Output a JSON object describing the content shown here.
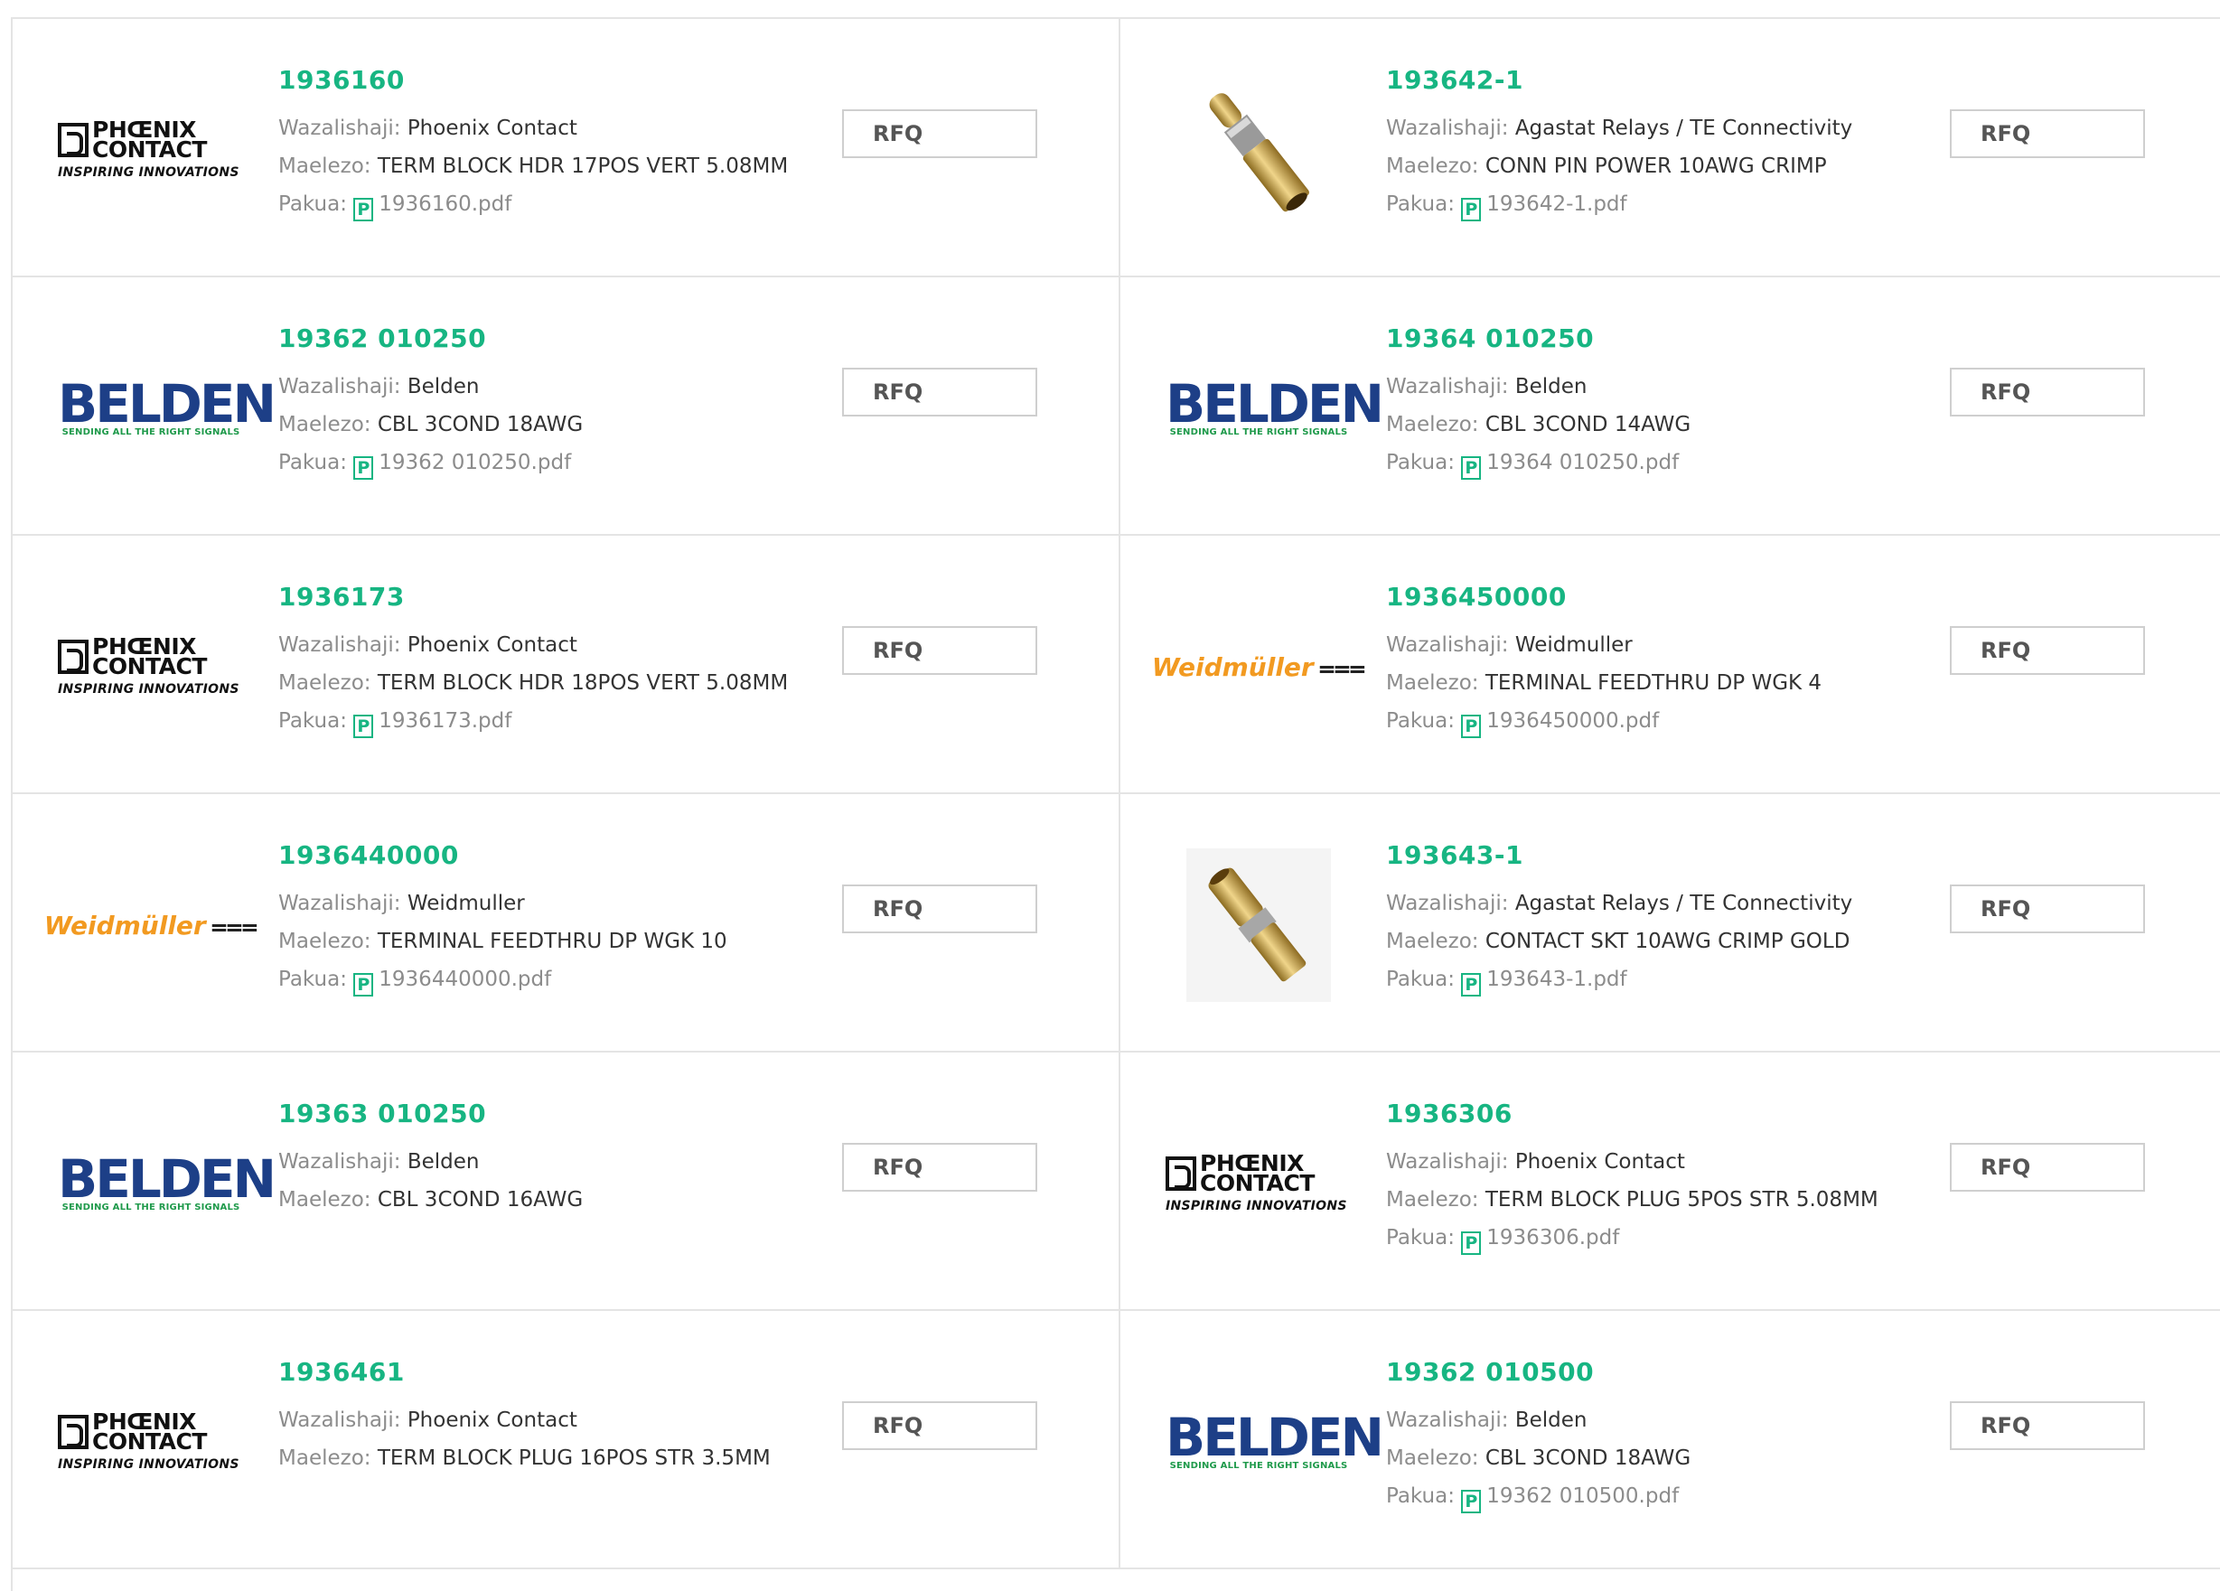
{
  "labels": {
    "manufacturer": "Wazalishaji:",
    "description": "Maelezo:",
    "package": "Pakua:",
    "rfq": "RFQ",
    "pdf_glyph": "P"
  },
  "logos": {
    "phoenix": {
      "line1": "PHŒNIX",
      "line2": "CONTACT",
      "tagline": "INSPIRING INNOVATIONS"
    },
    "belden": {
      "word": "BELDEN",
      "tagline": "SENDING ALL THE RIGHT SIGNALS"
    },
    "weidmuller": {
      "word": "Weidmüller",
      "symbol": "⩶"
    }
  },
  "colors": {
    "accent": "#17b582",
    "border": "#e4e4e4",
    "text": "#333333",
    "label": "#8c8c8c"
  },
  "products": [
    {
      "part": "1936160",
      "manufacturer": "Phoenix Contact",
      "description": "TERM BLOCK HDR 17POS VERT 5.08MM",
      "pdf": "1936160.pdf",
      "logo": "phoenix"
    },
    {
      "part": "193642-1",
      "manufacturer": "Agastat Relays / TE Connectivity",
      "description": "CONN PIN POWER 10AWG CRIMP",
      "pdf": "193642-1.pdf",
      "logo": "pin-photo"
    },
    {
      "part": "19362 010250",
      "manufacturer": "Belden",
      "description": "CBL 3COND 18AWG",
      "pdf": "19362 010250.pdf",
      "logo": "belden"
    },
    {
      "part": "19364 010250",
      "manufacturer": "Belden",
      "description": "CBL 3COND 14AWG",
      "pdf": "19364 010250.pdf",
      "logo": "belden"
    },
    {
      "part": "1936173",
      "manufacturer": "Phoenix Contact",
      "description": "TERM BLOCK HDR 18POS VERT 5.08MM",
      "pdf": "1936173.pdf",
      "logo": "phoenix"
    },
    {
      "part": "1936450000",
      "manufacturer": "Weidmuller",
      "description": "TERMINAL FEEDTHRU DP WGK 4",
      "pdf": "1936450000.pdf",
      "logo": "weidmuller"
    },
    {
      "part": "1936440000",
      "manufacturer": "Weidmuller",
      "description": "TERMINAL FEEDTHRU DP WGK 10",
      "pdf": "1936440000.pdf",
      "logo": "weidmuller"
    },
    {
      "part": "193643-1",
      "manufacturer": "Agastat Relays / TE Connectivity",
      "description": "CONTACT SKT 10AWG CRIMP GOLD",
      "pdf": "193643-1.pdf",
      "logo": "socket-photo"
    },
    {
      "part": "19363 010250",
      "manufacturer": "Belden",
      "description": "CBL 3COND 16AWG",
      "pdf": null,
      "logo": "belden"
    },
    {
      "part": "1936306",
      "manufacturer": "Phoenix Contact",
      "description": "TERM BLOCK PLUG 5POS STR 5.08MM",
      "pdf": "1936306.pdf",
      "logo": "phoenix"
    },
    {
      "part": "1936461",
      "manufacturer": "Phoenix Contact",
      "description": "TERM BLOCK PLUG 16POS STR 3.5MM",
      "pdf": null,
      "logo": "phoenix"
    },
    {
      "part": "19362 010500",
      "manufacturer": "Belden",
      "description": "CBL 3COND 18AWG",
      "pdf": "19362 010500.pdf",
      "logo": "belden"
    }
  ]
}
